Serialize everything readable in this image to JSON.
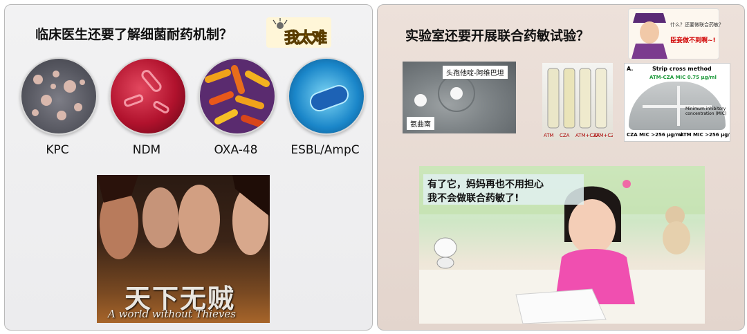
{
  "left_panel": {
    "title": "临床医生还要了解细菌耐药机制？",
    "sticker_text": "我太难",
    "bacteria": [
      {
        "label": "KPC"
      },
      {
        "label": "NDM"
      },
      {
        "label": "OXA-48"
      },
      {
        "label": "ESBL/AmpC"
      }
    ],
    "poster": {
      "title_cn": "天下无贼",
      "title_en": "A world without Thieves"
    }
  },
  "right_panel": {
    "title": "实验室还要开展联合药敏试验？",
    "meme": {
      "question": "什么？还要做联合药敏？",
      "answer": "臣妾做不到啊~!"
    },
    "disk_test": {
      "label_top": "头孢他啶-阿维巴坦",
      "label_bottom": "氨曲南"
    },
    "tube_labels": [
      "ATM",
      "CZA",
      "ATM+CZA",
      "ATM+CZA"
    ],
    "strip": {
      "panel_letter": "A.",
      "title": "Strip cross method",
      "mic_line": "ATM-CZA MIC 0.75 μg/ml",
      "note": "Minimum inhibitory concentration (MIC)",
      "left_mic": "CZA MIC >256 μg/ml",
      "right_mic": "ATM MIC >256 μg/ml"
    },
    "ad": {
      "line1": "有了它，妈妈再也不用担心",
      "line2": "我不会做联合药敏了!"
    }
  },
  "colors": {
    "left_bg": "#efeff0",
    "right_bg": "#e8dbd3",
    "meme_red": "#d00000",
    "strip_green": "#1f9a3c"
  }
}
